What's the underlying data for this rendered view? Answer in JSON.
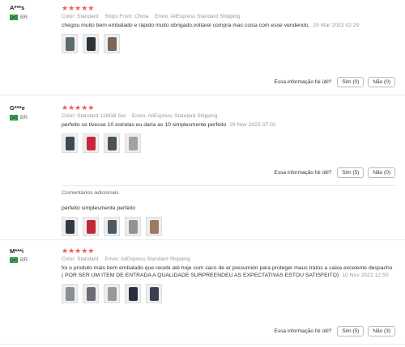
{
  "labels": {
    "color": "Color:",
    "ships_from": "Ships From:",
    "envio": "Envio:",
    "helpful": "Essa informação foi útil?",
    "additional": "Comentários adicionais"
  },
  "colors": {
    "star": "#f25c54",
    "meta": "#999999"
  },
  "reviews": [
    {
      "author": "A***s",
      "country": "BR",
      "stars": "★★★★★",
      "color": "Standard",
      "ships_from": "China",
      "shipping": "AliExpress Standard Shipping",
      "text": "chegou muito bem embalado e rápido muito obrigado,voltarei compra mas coisa com esse vendendo.",
      "date": "20 Mar 2023 02:29",
      "yes": "Sim (0)",
      "no": "Não (0)",
      "photo_count": 3
    },
    {
      "author": "G***e",
      "country": "BR",
      "stars": "★★★★★",
      "color": "Standard 128GB Set",
      "shipping": "AliExpress Standard Shipping",
      "text": "perfeito se tivesse 10 estrelas eu daria as 10 simplesmente perfeito",
      "date": "29 Nov 2022 07:02",
      "yes": "Sim (5)",
      "no": "Não (0)",
      "photo_count": 4,
      "additional": {
        "text": "perfeito simplesmente perfeito",
        "photo_count": 5
      }
    },
    {
      "author": "M***i",
      "country": "BR",
      "stars": "★★★★★",
      "color": "Standard",
      "shipping": "AliExpress Standard Shipping",
      "text": "foi o produto mais bem embalado que recebi até hoje com saco de ar presumido para proteger maus tratos a caixa excelente despacho ( POR SER UM ITEM DE ENTRADA A QUALIDADE SURPREENDEU AS EXPECTATIVAS ESTOU SATISFEITO)",
      "date": "10 Nov 2022 12:50",
      "yes": "Sim (5)",
      "no": "Não (3)",
      "photo_count": 5
    }
  ]
}
